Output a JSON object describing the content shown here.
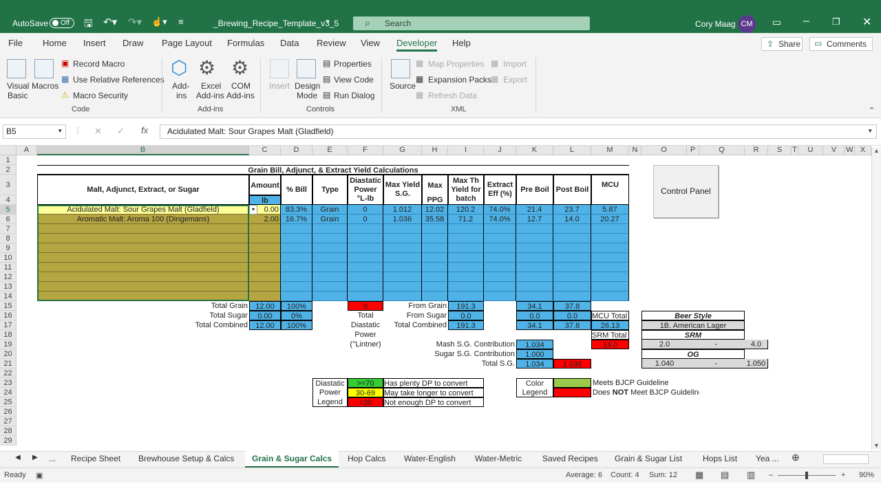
{
  "title": {
    "autosave": "AutoSave",
    "toggle": "Off",
    "filename": "_Brewing_Recipe_Template_v3_5",
    "search": "Search",
    "user": "Cory Maag",
    "initials": "CM"
  },
  "menu": [
    "File",
    "Home",
    "Insert",
    "Draw",
    "Page Layout",
    "Formulas",
    "Data",
    "Review",
    "View",
    "Developer",
    "Help"
  ],
  "share": "Share",
  "comments": "Comments",
  "ribbon": {
    "code": {
      "visual_basic": "Visual",
      "visual_basic2": "Basic",
      "macros": "Macros",
      "record": "Record Macro",
      "relative": "Use Relative References",
      "security": "Macro Security",
      "label": "Code"
    },
    "addins": {
      "addins": "Add-",
      "addins2": "ins",
      "excel": "Excel",
      "excel2": "Add-ins",
      "com": "COM",
      "com2": "Add-ins",
      "label": "Add-ins"
    },
    "controls": {
      "insert": "Insert",
      "design": "Design",
      "design2": "Mode",
      "properties": "Properties",
      "viewcode": "View Code",
      "rundialog": "Run Dialog",
      "label": "Controls"
    },
    "xml": {
      "source": "Source",
      "map": "Map Properties",
      "expansion": "Expansion Packs",
      "refresh": "Refresh Data",
      "import": "Import",
      "export": "Export",
      "label": "XML"
    }
  },
  "namebox": "B5",
  "formula": "Acidulated Malt: Sour Grapes Malt (Gladfield)",
  "columns": [
    "A",
    "B",
    "C",
    "D",
    "E",
    "F",
    "G",
    "H",
    "I",
    "J",
    "K",
    "L",
    "M",
    "N",
    "O",
    "P",
    "Q",
    "R",
    "S",
    "T",
    "U",
    "V",
    "W",
    "X"
  ],
  "rows": [
    "1",
    "2",
    "3",
    "4",
    "5",
    "6",
    "7",
    "8",
    "9",
    "10",
    "11",
    "12",
    "13",
    "14",
    "15",
    "16",
    "17",
    "18",
    "19",
    "20",
    "21",
    "22",
    "23",
    "24",
    "25",
    "26",
    "27",
    "28",
    "29"
  ],
  "sheet": {
    "heading": "Grain Bill, Adjunct, & Extract Yield Calculations",
    "headers": {
      "malt": "Malt, Adjunct, Extract, or Sugar",
      "amount": "Amount",
      "unit": "lb",
      "bill": "% Bill",
      "type": "Type",
      "dp": "Diastatic Power °L-lb",
      "maxsg": "Max Yield S.G.",
      "maxppg1": "Max",
      "maxppg2": "PPG",
      "maxth": "Max Th Yield for batch",
      "eff": "Extract Eff (%)",
      "preboil": "Pre Boil",
      "postboil": "Post Boil",
      "mcu": "MCU"
    },
    "rows": [
      {
        "name": "Acidulated Malt: Sour Grapes Malt (Gladfield)",
        "amount": "0.00",
        "bill": "83.3%",
        "type": "Grain",
        "dp": "0",
        "maxsg": "1.012",
        "ppg": "12.02",
        "maxth": "120.2",
        "eff": "74.0%",
        "pre": "21.4",
        "post": "23.7",
        "mcu": "5.87"
      },
      {
        "name": "Aromatic Malt: Aroma 100 (Dingemans)",
        "amount": "2.00",
        "bill": "16.7%",
        "type": "Grain",
        "dp": "0",
        "maxsg": "1.036",
        "ppg": "35.58",
        "maxth": "71.2",
        "eff": "74.0%",
        "pre": "12.7",
        "post": "14.0",
        "mcu": "20.27"
      }
    ],
    "totals": {
      "grain_label": "Total Grain",
      "grain": "12.00",
      "grain_pct": "100%",
      "sugar_label": "Total Sugar",
      "sugar": "0.00",
      "sugar_pct": "0%",
      "combined_label": "Total Combined",
      "combined": "12.00",
      "combined_pct": "100%",
      "dp_total": "0",
      "dp_label1": "Total",
      "dp_label2": "Diastatic",
      "dp_label3": "Power",
      "dp_label4": "(°Lintner)",
      "from_grain_label": "From Grain",
      "from_grain": "191.3",
      "from_sugar_label": "From Sugar",
      "from_sugar": "0.0",
      "total_combined_label": "Total Combined",
      "total_combined": "191.3",
      "pre15": "34.1",
      "post15": "37.8",
      "pre16": "0.0",
      "post16": "0.0",
      "pre17": "34.1",
      "post17": "37.8",
      "mcu_total_label": "MCU Total",
      "mcu_total": "26.13",
      "srm_total_label": "SRM Total",
      "srm_total": "14.0",
      "mash_label": "Mash S.G. Contribution",
      "mash": "1.034",
      "sugar_sg_label": "Sugar S.G. Contribution",
      "sugar_sg": "1.000",
      "total_sg_label": "Total S.G.",
      "total_sg": "1.034",
      "total_sg_red": "1.038"
    },
    "style": {
      "beer_style_label": "Beer Style",
      "beer_style": "1B. American Lager",
      "srm_label": "SRM",
      "srm_low": "2.0",
      "dash": "-",
      "srm_high": "4.0",
      "og_label": "OG",
      "og_low": "1.040",
      "og_high": "1.050"
    },
    "legend": {
      "dp1": "Diastatic",
      "dp2": "Power",
      "dp3": "Legend",
      "g": ">=70",
      "y": "30-69",
      "r": "<30",
      "g_text": "Has plenty DP to convert",
      "y_text": "May take longer to convert",
      "r_text": "Not enough DP to convert",
      "color1": "Color",
      "color2": "Legend",
      "meets": "Meets BJCP Guideline",
      "does": "Does ",
      "not": "NOT",
      "meet": " Meet BJCP Guideline"
    },
    "control_panel": "Control Panel"
  },
  "tabs": [
    "...",
    "Recipe Sheet",
    "Brewhouse Setup & Calcs",
    "Grain & Sugar Calcs",
    "Hop Calcs",
    "Water-English",
    "Water-Metric",
    "Saved Recipes",
    "Grain & Sugar List",
    "Hops List",
    "Yea ..."
  ],
  "status": {
    "ready": "Ready",
    "average": "Average: 6",
    "count": "Count: 4",
    "sum": "Sum: 12",
    "zoom": "90%"
  },
  "colors": {
    "accent": "#217346",
    "blue_cell": "#4fb3e7",
    "olive_cell": "#b5a642",
    "red": "#ff0000",
    "green": "#9bc94a",
    "yellow": "#ffff00"
  }
}
